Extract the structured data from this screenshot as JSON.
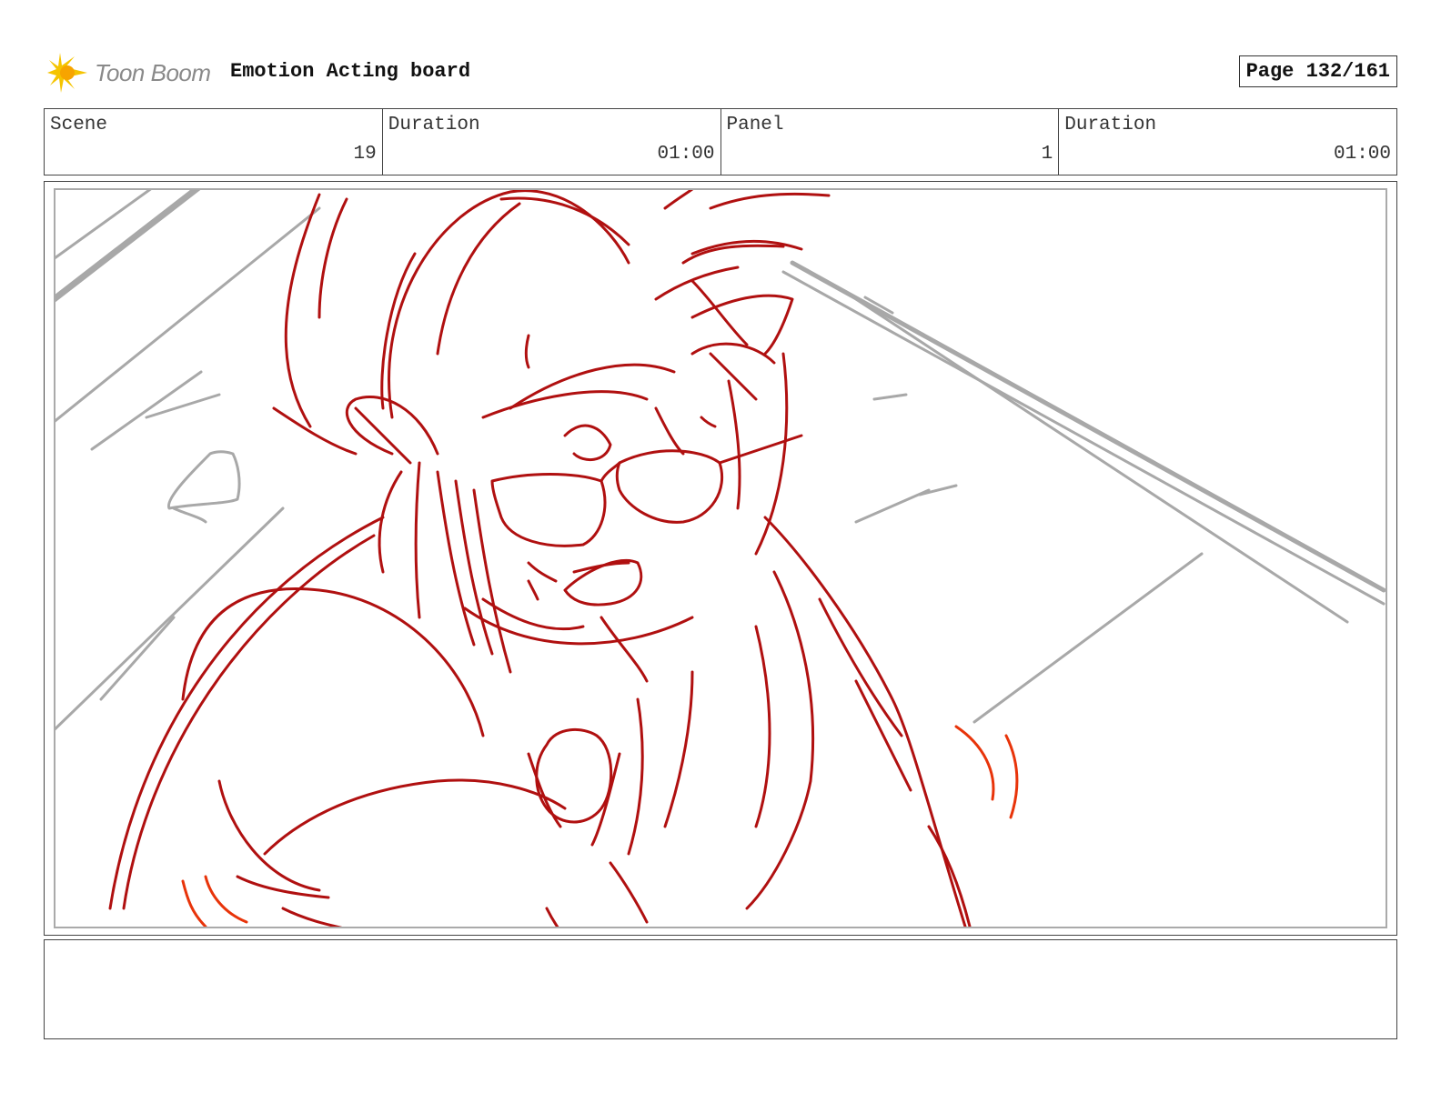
{
  "header": {
    "logo_text": "Toon Boom",
    "board_title": "Emotion Acting board",
    "page_label": "Page 132/161"
  },
  "info": {
    "scene_label": "Scene",
    "scene_value": "19",
    "scene_duration_label": "Duration",
    "scene_duration_value": "01:00",
    "panel_label": "Panel",
    "panel_value": "1",
    "panel_duration_label": "Duration",
    "panel_duration_value": "01:00"
  },
  "colors": {
    "sketch_red": "#b01010",
    "sketch_orange": "#e8340a",
    "sketch_gray": "#aaaaaa",
    "logo_yellow": "#f5c400"
  },
  "notes": {
    "text": ""
  }
}
